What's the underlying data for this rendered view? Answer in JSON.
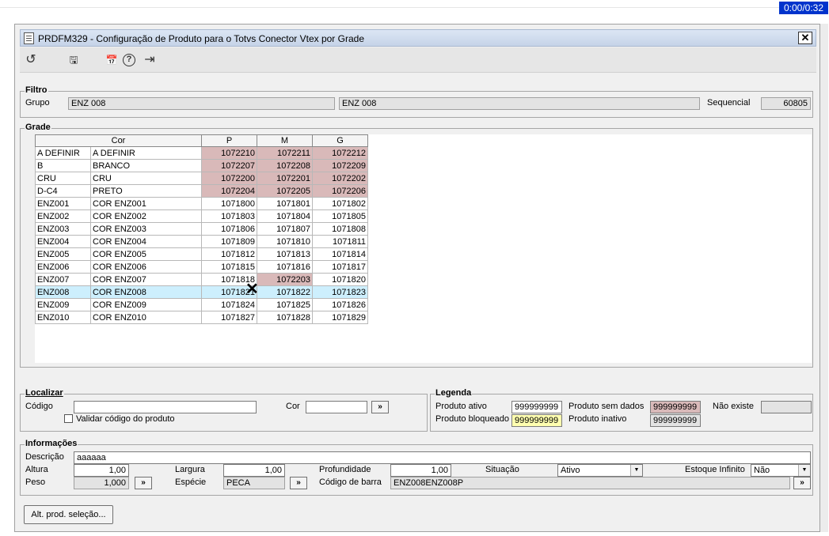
{
  "timer": "0:00/0:32",
  "window": {
    "title": "PRDFM329 - Configuração de Produto para o Totvs Conector Vtex por Grade",
    "close_glyph": "✕"
  },
  "toolbar": {
    "icons": [
      "undo-icon",
      "save-icon",
      "calendar-icon",
      "help-icon",
      "exit-icon"
    ],
    "undo_glyph": "↺",
    "save_glyph": "🖫",
    "calendar_glyph": "📅",
    "help_glyph": "?",
    "exit_glyph": "⇥"
  },
  "filtro": {
    "legend": "Filtro",
    "grupo_label": "Grupo",
    "grupo_code": "ENZ 008",
    "grupo_desc": "ENZ 008",
    "sequencial_label": "Sequencial",
    "sequencial_value": "60805"
  },
  "grade": {
    "legend": "Grade",
    "headers": [
      "Cor",
      "P",
      "M",
      "G"
    ],
    "rows": [
      {
        "code": "A DEFINIR",
        "desc": "A DEFINIR",
        "p": "1072210",
        "m": "1072211",
        "g": "1072212",
        "nodata": [
          "p",
          "m",
          "g"
        ]
      },
      {
        "code": "B",
        "desc": "BRANCO",
        "p": "1072207",
        "m": "1072208",
        "g": "1072209",
        "nodata": [
          "p",
          "m",
          "g"
        ]
      },
      {
        "code": "CRU",
        "desc": "CRU",
        "p": "1072200",
        "m": "1072201",
        "g": "1072202",
        "nodata": [
          "p",
          "m",
          "g"
        ]
      },
      {
        "code": "D-C4",
        "desc": "PRETO",
        "p": "1072204",
        "m": "1072205",
        "g": "1072206",
        "nodata": [
          "p",
          "m",
          "g"
        ]
      },
      {
        "code": "ENZ001",
        "desc": "COR ENZ001",
        "p": "1071800",
        "m": "1071801",
        "g": "1071802",
        "nodata": []
      },
      {
        "code": "ENZ002",
        "desc": "COR ENZ002",
        "p": "1071803",
        "m": "1071804",
        "g": "1071805",
        "nodata": []
      },
      {
        "code": "ENZ003",
        "desc": "COR ENZ003",
        "p": "1071806",
        "m": "1071807",
        "g": "1071808",
        "nodata": []
      },
      {
        "code": "ENZ004",
        "desc": "COR ENZ004",
        "p": "1071809",
        "m": "1071810",
        "g": "1071811",
        "nodata": []
      },
      {
        "code": "ENZ005",
        "desc": "COR ENZ005",
        "p": "1071812",
        "m": "1071813",
        "g": "1071814",
        "nodata": []
      },
      {
        "code": "ENZ006",
        "desc": "COR ENZ006",
        "p": "1071815",
        "m": "1071816",
        "g": "1071817",
        "nodata": []
      },
      {
        "code": "ENZ007",
        "desc": "COR ENZ007",
        "p": "1071818",
        "m": "1072203",
        "g": "1071820",
        "nodata": [
          "m"
        ]
      },
      {
        "code": "ENZ008",
        "desc": "COR ENZ008",
        "p": "1071821",
        "m": "1071822",
        "g": "1071823",
        "nodata": [],
        "selected": true
      },
      {
        "code": "ENZ009",
        "desc": "COR ENZ009",
        "p": "1071824",
        "m": "1071825",
        "g": "1071826",
        "nodata": []
      },
      {
        "code": "ENZ010",
        "desc": "COR ENZ010",
        "p": "1071827",
        "m": "1071828",
        "g": "1071829",
        "nodata": []
      }
    ]
  },
  "localizar": {
    "legend": "Localizar",
    "codigo_label": "Código",
    "codigo_value": "",
    "cor_label": "Cor",
    "cor_value": "",
    "search_btn": "»",
    "validar_label": "Validar código do produto",
    "validar_checked": false
  },
  "legenda": {
    "legend": "Legenda",
    "ativo_label": "Produto ativo",
    "ativo_sample": "999999999",
    "ativo_color": "#ffffff",
    "bloqueado_label": "Produto bloqueado",
    "bloqueado_sample": "999999999",
    "bloqueado_color": "#ffffb0",
    "semdados_label": "Produto sem dados",
    "semdados_sample": "999999999",
    "semdados_color": "#d9b9b9",
    "inativo_label": "Produto inativo",
    "inativo_sample": "999999999",
    "inativo_color": "#e3e3e3",
    "naoexiste_label": "Não existe",
    "naoexiste_color": "#e3e3e3"
  },
  "informacoes": {
    "legend": "Informações",
    "descricao_label": "Descrição",
    "descricao_value": "aaaaaa",
    "altura_label": "Altura",
    "altura_value": "1,00",
    "largura_label": "Largura",
    "largura_value": "1,00",
    "profundidade_label": "Profundidade",
    "profundidade_value": "1,00",
    "situacao_label": "Situação",
    "situacao_value": "Ativo",
    "estoque_label": "Estoque Infinito",
    "estoque_value": "Não",
    "peso_label": "Peso",
    "peso_value": "1,000",
    "especie_label": "Espécie",
    "especie_value": "PECA",
    "codbarra_label": "Código de barra",
    "codbarra_value": "ENZ008ENZ008P",
    "more_btn": "»"
  },
  "actions": {
    "alt_selecao": "Alt. prod. seleção..."
  }
}
